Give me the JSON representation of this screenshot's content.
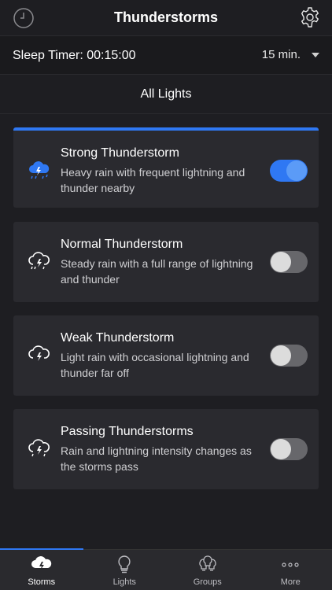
{
  "header": {
    "title": "Thunderstorms",
    "left_icon": "clock-icon",
    "right_icon": "gear-icon"
  },
  "sleep_timer": {
    "label": "Sleep Timer: 00:15:00",
    "selected": "15 min."
  },
  "section": {
    "title": "All Lights"
  },
  "cards": [
    {
      "name": "Strong Thunderstorm",
      "desc": "Heavy rain with frequent lightning and thunder nearby",
      "on": true
    },
    {
      "name": "Normal Thunderstorm",
      "desc": "Steady rain with a full range of lightning and thunder",
      "on": false
    },
    {
      "name": "Weak Thunderstorm",
      "desc": "Light rain with occasional lightning and thunder far off",
      "on": false
    },
    {
      "name": "Passing Thunderstorms",
      "desc": "Rain and lightning intensity changes as the storms pass",
      "on": false
    }
  ],
  "colors": {
    "accent": "#2f78f3",
    "background": "#1e1e22",
    "card": "#2a2a2f"
  },
  "tabs": [
    {
      "label": "Storms",
      "icon": "storm-icon",
      "active": true
    },
    {
      "label": "Lights",
      "icon": "bulb-icon",
      "active": false
    },
    {
      "label": "Groups",
      "icon": "bulbs-group-icon",
      "active": false
    },
    {
      "label": "More",
      "icon": "more-dots-icon",
      "active": false
    }
  ]
}
